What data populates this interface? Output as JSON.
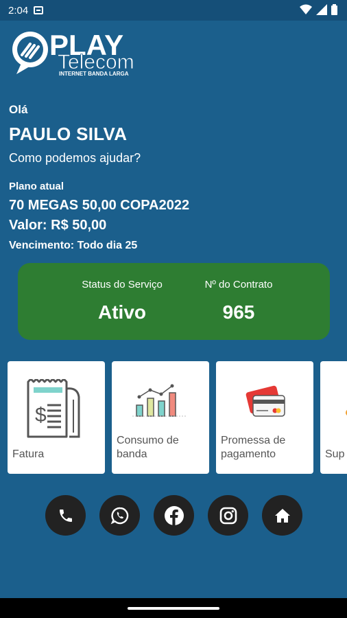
{
  "status_bar": {
    "time": "2:04"
  },
  "brand": {
    "name_top": "PLAY",
    "name_bottom": "Telecom",
    "tagline": "INTERNET BANDA LARGA"
  },
  "greeting": {
    "hello": "Olá",
    "user_name": "PAULO SILVA",
    "question": "Como podemos ajudar?"
  },
  "plan": {
    "label": "Plano atual",
    "name": "70 MEGAS 50,00 COPA2022",
    "value": "Valor: R$ 50,00",
    "due": "Vencimento: Todo dia 25"
  },
  "service_card": {
    "status_label": "Status do Serviço",
    "status_value": "Ativo",
    "contract_label": "Nº do Contrato",
    "contract_value": "965",
    "color": "#2e7d32"
  },
  "menu_tiles": [
    {
      "label": "Fatura",
      "icon": "invoice-icon"
    },
    {
      "label": "Consumo de banda",
      "icon": "bandwidth-chart-icon"
    },
    {
      "label": "Promessa de pagamento",
      "icon": "credit-card-icon"
    },
    {
      "label": "Sup",
      "icon": "support-icon"
    }
  ],
  "social_buttons": [
    {
      "icon": "phone-icon"
    },
    {
      "icon": "whatsapp-icon"
    },
    {
      "icon": "facebook-icon"
    },
    {
      "icon": "instagram-icon"
    },
    {
      "icon": "home-icon"
    }
  ],
  "colors": {
    "background": "#1b5f8c",
    "status_bar": "#154f78",
    "card_green": "#2e7d32",
    "button_dark": "#222222"
  }
}
